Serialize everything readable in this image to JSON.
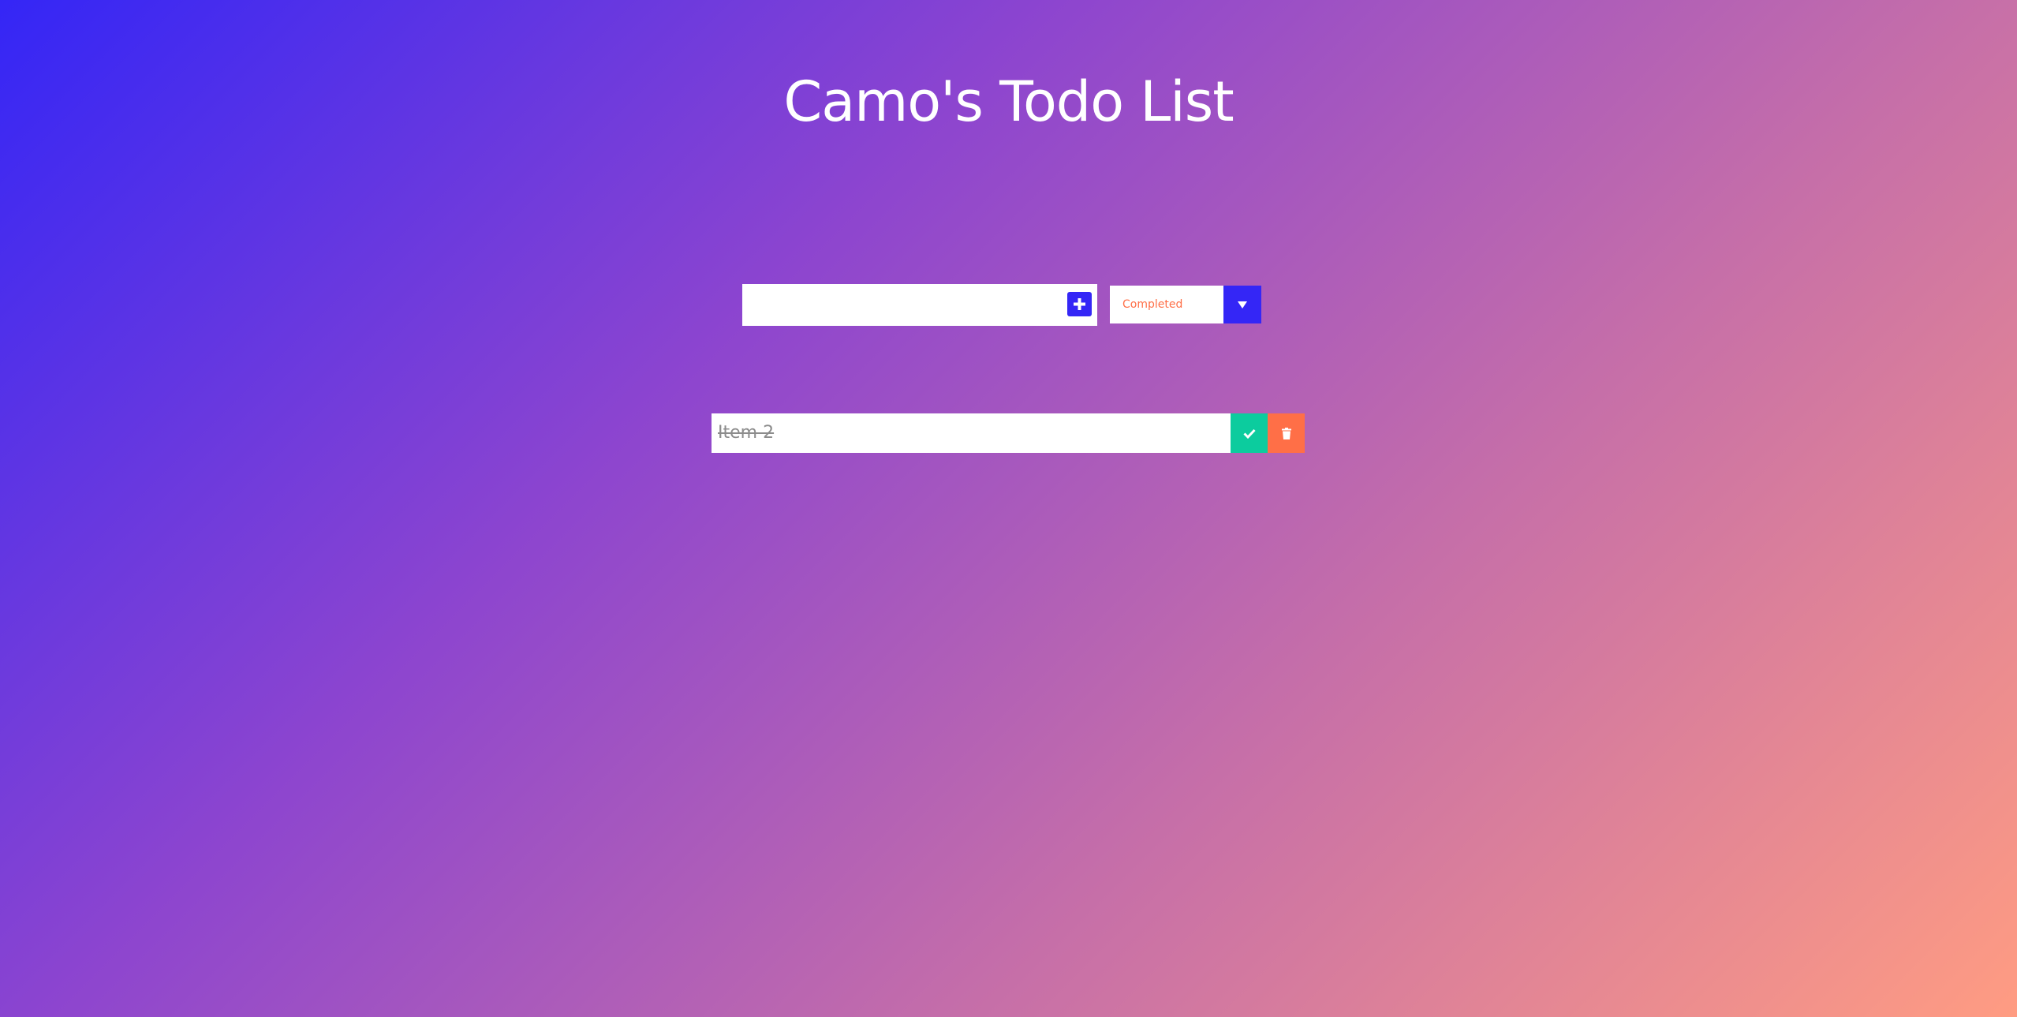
{
  "header": {
    "title": "Camo's Todo List"
  },
  "form": {
    "input_value": "",
    "input_placeholder": "",
    "add_icon": "plus-square-icon"
  },
  "filter": {
    "selected": "Completed",
    "arrow_icon": "caret-down-icon"
  },
  "todos": [
    {
      "text": "Item 2",
      "completed": true,
      "complete_icon": "check-icon",
      "delete_icon": "trash-icon"
    }
  ],
  "colors": {
    "accent": "#3426f6",
    "complete": "#0ccc9e",
    "delete": "#ff6f47",
    "gradient_start": "#3426f6",
    "gradient_end": "#ff9c82"
  }
}
